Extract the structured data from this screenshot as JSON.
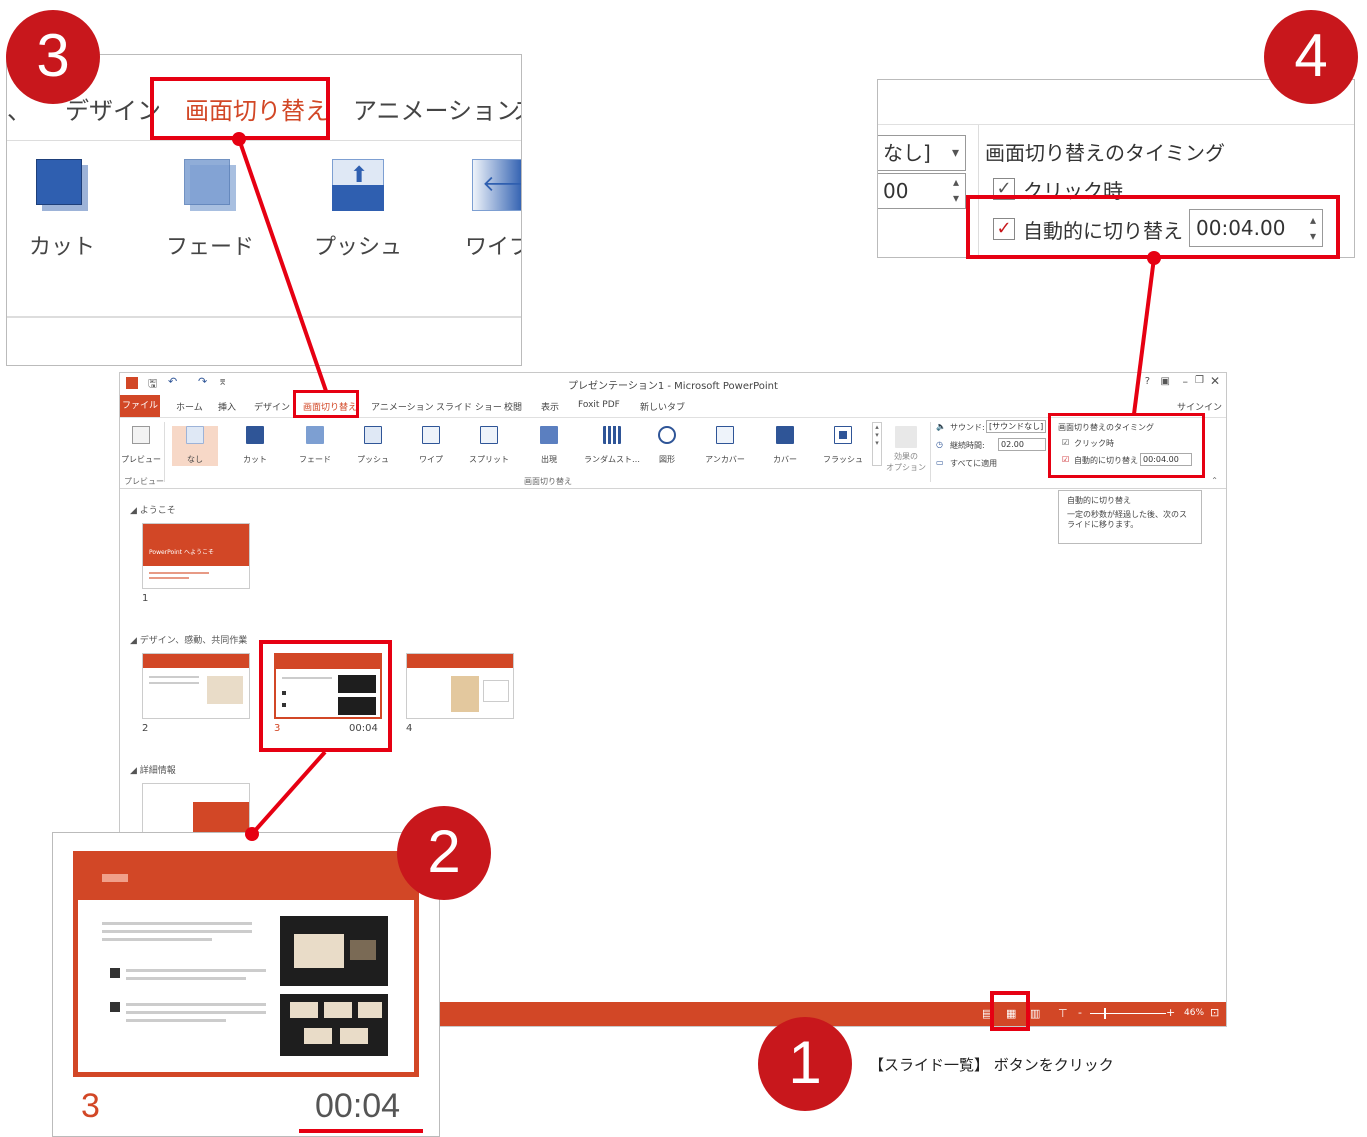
{
  "badges": {
    "b1": "1",
    "b2": "2",
    "b3": "3",
    "b4": "4"
  },
  "caption": "【スライド一覧】 ボタンをクリック",
  "zoom3": {
    "tab_left": "デザイン",
    "tab_active": "画面切り替え",
    "tab_right": "アニメーション",
    "tab_cut": "ス",
    "effects": [
      "カット",
      "フェード",
      "プッシュ",
      "ワイプ"
    ]
  },
  "zoom4": {
    "sound_value": "なし]",
    "duration_value": "00",
    "group_title": "画面切り替えのタイミング",
    "on_click_label": "クリック時",
    "auto_label": "自動的に切り替え",
    "auto_time": "00:04.00"
  },
  "ppt": {
    "title": "プレゼンテーション1 - Microsoft PowerPoint",
    "sign_in": "サインイン",
    "tabs": [
      "ファイル",
      "ホーム",
      "挿入",
      "デザイン",
      "画面切り替え",
      "アニメーション",
      "スライド ショー",
      "校閲",
      "表示",
      "Foxit PDF",
      "新しいタブ"
    ],
    "preview_label": "プレビュー",
    "preview_group": "プレビュー",
    "transitions_group": "画面切り替え",
    "effects": [
      "なし",
      "カット",
      "フェード",
      "プッシュ",
      "ワイプ",
      "スプリット",
      "出現",
      "ランダムスト…",
      "図形",
      "アンカバー",
      "カバー",
      "フラッシュ"
    ],
    "effect_options_line1": "効果の",
    "effect_options_line2": "オプション",
    "sound_label": "サウンド:",
    "sound_value": "[サウンドなし]",
    "duration_label": "継続時間:",
    "duration_value": "02.00",
    "apply_all": "すべてに適用",
    "timing_title": "画面切り替えのタイミング",
    "on_click": "クリック時",
    "auto": "自動的に切り替え",
    "auto_time": "00:04.00",
    "tooltip_title": "自動的に切り替え",
    "tooltip_body": "一定の秒数が経過した後、次のスライドに移ります。",
    "sections": [
      "ようこそ",
      "デザイン、感動、共同作業",
      "詳細情報"
    ],
    "slide1_title": "PowerPoint へようこそ",
    "slides": [
      {
        "num": "1"
      },
      {
        "num": "2"
      },
      {
        "num": "3",
        "time": "00:04"
      },
      {
        "num": "4"
      }
    ],
    "zoom_level": "46%"
  },
  "zoom2": {
    "num": "3",
    "time": "00:04"
  },
  "colors": {
    "accent": "#d24726",
    "callout": "#e60012",
    "badge": "#c8171c"
  }
}
